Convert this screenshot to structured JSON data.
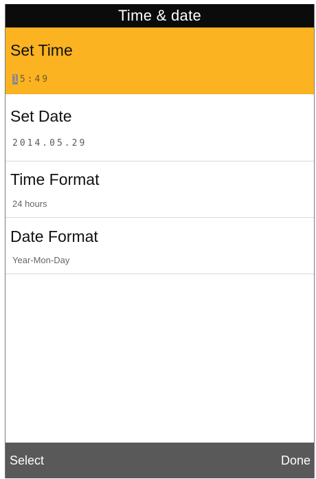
{
  "header": {
    "title": "Time & date"
  },
  "settings": {
    "items": [
      {
        "label": "Set Time",
        "value_cursor": "1",
        "value_rest": "5:49",
        "selected": true
      },
      {
        "label": "Set Date",
        "value": "2014.05.29"
      },
      {
        "label": "Time Format",
        "value": "24 hours"
      },
      {
        "label": "Date Format",
        "value": "Year-Mon-Day"
      }
    ]
  },
  "softkeys": {
    "left": "Select",
    "right": "Done"
  },
  "colors": {
    "selection": "#fbb321",
    "title_bar": "#0b0b0b",
    "softkey_bar": "#595959"
  }
}
